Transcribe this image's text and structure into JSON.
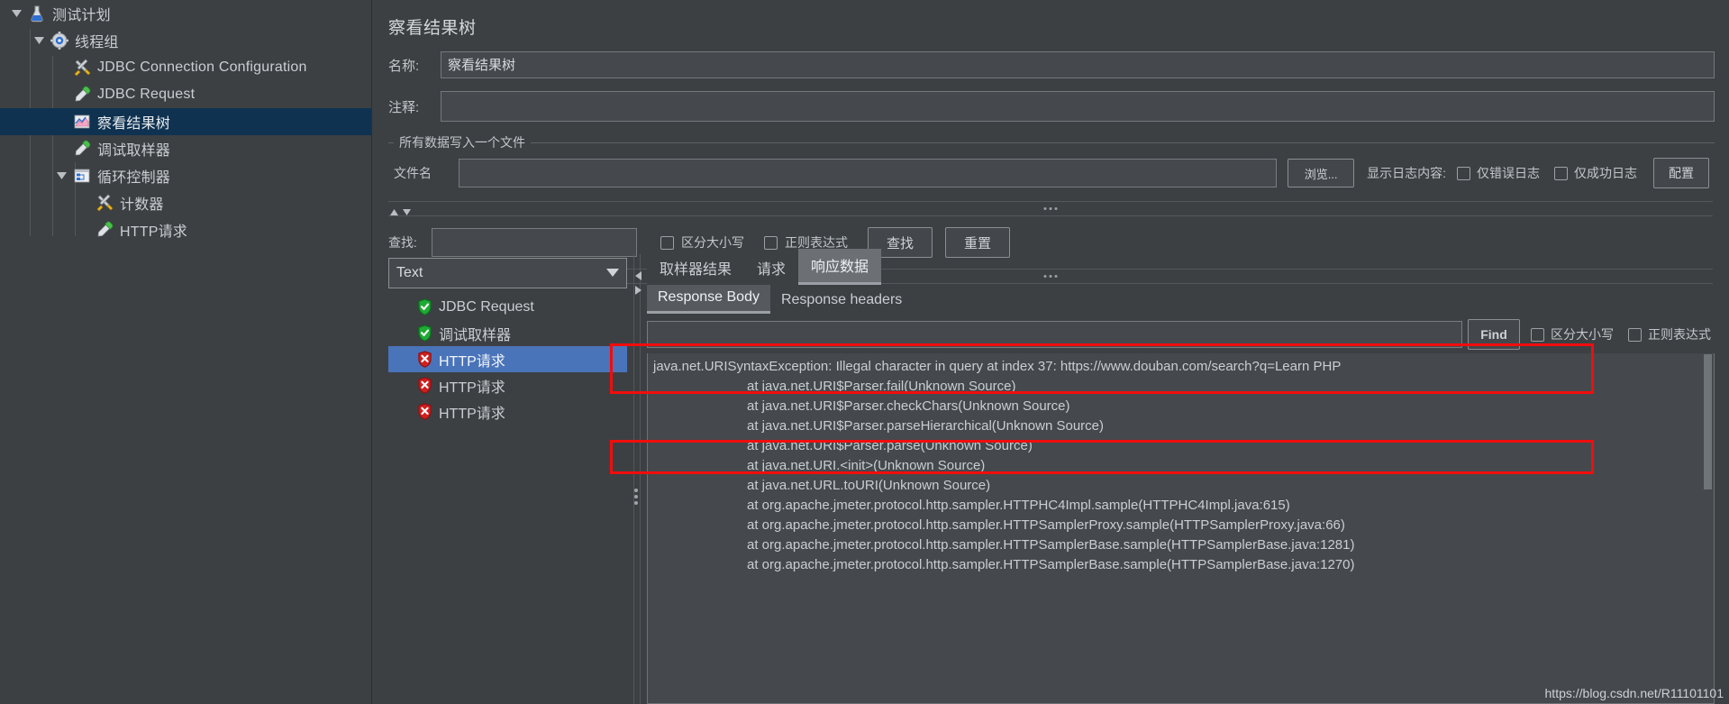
{
  "tree": {
    "items": [
      {
        "label": "测试计划",
        "icon": "flask-icon",
        "depth": 0,
        "twisty": "down",
        "selected": false
      },
      {
        "label": "线程组",
        "icon": "gear-icon",
        "depth": 1,
        "twisty": "down",
        "selected": false
      },
      {
        "label": "JDBC Connection Configuration",
        "icon": "tools-icon",
        "depth": 2,
        "twisty": "none",
        "selected": false
      },
      {
        "label": "JDBC Request",
        "icon": "pipette-icon",
        "depth": 2,
        "twisty": "none",
        "selected": false
      },
      {
        "label": "察看结果树",
        "icon": "chart-icon",
        "depth": 2,
        "twisty": "none",
        "selected": true
      },
      {
        "label": "调试取样器",
        "icon": "pipette-icon",
        "depth": 2,
        "twisty": "none",
        "selected": false
      },
      {
        "label": "循环控制器",
        "icon": "controller-icon",
        "depth": 2,
        "twisty": "down",
        "selected": false
      },
      {
        "label": "计数器",
        "icon": "tools-icon",
        "depth": 3,
        "twisty": "none",
        "selected": false
      },
      {
        "label": "HTTP请求",
        "icon": "pipette-icon",
        "depth": 3,
        "twisty": "none",
        "selected": false
      }
    ]
  },
  "panel": {
    "title": "察看结果树",
    "name_label": "名称:",
    "name_value": "察看结果树",
    "comment_label": "注释:",
    "comment_value": "",
    "file_group": {
      "legend": "所有数据写入一个文件",
      "filename_label": "文件名",
      "filename_value": "",
      "browse_button": "浏览...",
      "show_log_label": "显示日志内容:",
      "errors_only": "仅错误日志",
      "success_only": "仅成功日志",
      "config_button": "配置"
    },
    "search": {
      "label": "查找:",
      "value": "",
      "case_sensitive": "区分大小写",
      "regex": "正则表达式",
      "find_button": "查找",
      "reset_button": "重置"
    }
  },
  "bottom": {
    "renderer_selected": "Text",
    "results": [
      {
        "label": "JDBC Request",
        "status": "success",
        "selected": false
      },
      {
        "label": "调试取样器",
        "status": "success",
        "selected": false
      },
      {
        "label": "HTTP请求",
        "status": "error",
        "selected": true
      },
      {
        "label": "HTTP请求",
        "status": "error",
        "selected": false
      },
      {
        "label": "HTTP请求",
        "status": "error",
        "selected": false
      }
    ],
    "tabs": [
      {
        "label": "取样器结果",
        "active": false
      },
      {
        "label": "请求",
        "active": false
      },
      {
        "label": "响应数据",
        "active": true
      }
    ],
    "subtabs": [
      {
        "label": "Response Body",
        "active": true
      },
      {
        "label": "Response headers",
        "active": false
      }
    ],
    "find": {
      "value": "",
      "find_button": "Find",
      "case_sensitive": "区分大小写",
      "regex": "正则表达式"
    },
    "response_lines": [
      {
        "text": "java.net.URISyntaxException: Illegal character in query at index 37: https://www.douban.com/search?q=Learn PHP",
        "indent": false
      },
      {
        "text": "at java.net.URI$Parser.fail(Unknown Source)",
        "indent": true
      },
      {
        "text": "at java.net.URI$Parser.checkChars(Unknown Source)",
        "indent": true
      },
      {
        "text": "at java.net.URI$Parser.parseHierarchical(Unknown Source)",
        "indent": true
      },
      {
        "text": "at java.net.URI$Parser.parse(Unknown Source)",
        "indent": true
      },
      {
        "text": "at java.net.URI.<init>(Unknown Source)",
        "indent": true
      },
      {
        "text": "at java.net.URL.toURI(Unknown Source)",
        "indent": true
      },
      {
        "text": "at org.apache.jmeter.protocol.http.sampler.HTTPHC4Impl.sample(HTTPHC4Impl.java:615)",
        "indent": true
      },
      {
        "text": "at org.apache.jmeter.protocol.http.sampler.HTTPSamplerProxy.sample(HTTPSamplerProxy.java:66)",
        "indent": true
      },
      {
        "text": "at org.apache.jmeter.protocol.http.sampler.HTTPSamplerBase.sample(HTTPSamplerBase.java:1281)",
        "indent": true
      },
      {
        "text": "at org.apache.jmeter.protocol.http.sampler.HTTPSamplerBase.sample(HTTPSamplerBase.java:1270)",
        "indent": true
      }
    ]
  },
  "watermark": "https://blog.csdn.net/R11101101",
  "colors": {
    "background": "#3c4043",
    "tree_selected": "#0f3250",
    "list_selected": "#4a74ba",
    "highlight_box": "#f20d0d",
    "success": "#1faa34",
    "error": "#cf2020"
  }
}
